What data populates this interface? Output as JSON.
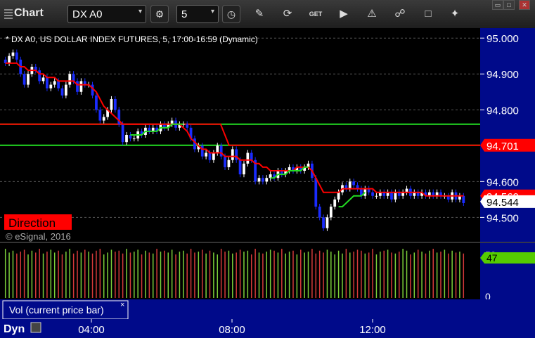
{
  "app": {
    "title": "Chart"
  },
  "toolbar": {
    "symbol": "DX A0",
    "interval": "5",
    "icons": [
      "settings-gear-icon",
      "clock-icon",
      "pencil-icon",
      "refresh-icon",
      "get-icon",
      "play-icon",
      "alert-icon",
      "link-icon",
      "note-icon",
      "twitter-icon"
    ]
  },
  "chart_header": "* DX A0, US DOLLAR INDEX FUTURES, 5, 17:00-16:59 (Dynamic)",
  "watermark": "© eSignal, 2016",
  "direction_label": "Direction",
  "volume_panel": {
    "label": "Vol (current price bar)",
    "current_value": "47",
    "scale_top": "50",
    "scale_bottom": "0"
  },
  "time_axis": {
    "labels": [
      "04:00",
      "08:00",
      "12:00"
    ],
    "left_label": "Dyn"
  },
  "colors": {
    "background": "#000000",
    "up_candle": "#ffffff",
    "down_candle": "#1a2cff",
    "ma_red": "#ff0000",
    "ma_green": "#22dd22",
    "price_tag_red": "#ff0000",
    "vol_tag_green": "#55cc00",
    "axis_blue": "#000a8a"
  },
  "chart_data": {
    "type": "candlestick",
    "symbol": "DX A0",
    "description": "US DOLLAR INDEX FUTURES",
    "interval": "5",
    "session": "17:00-16:59",
    "ylim": [
      94.44,
      95.02
    ],
    "y_ticks": [
      "95.000",
      "94.900",
      "94.800",
      "94.600",
      "94.500"
    ],
    "x_labels": [
      "04:00",
      "08:00",
      "12:00"
    ],
    "price_tags": [
      {
        "value": "94.701",
        "color": "red"
      },
      {
        "value": "94.560",
        "color": "red"
      },
      {
        "value": "94.544",
        "color": "white"
      }
    ],
    "close": [
      94.93,
      94.95,
      94.96,
      94.94,
      94.9,
      94.87,
      94.9,
      94.92,
      94.91,
      94.88,
      94.89,
      94.86,
      94.87,
      94.88,
      94.86,
      94.84,
      94.87,
      94.9,
      94.88,
      94.85,
      94.88,
      94.87,
      94.87,
      94.84,
      94.8,
      94.77,
      94.78,
      94.8,
      94.83,
      94.8,
      94.76,
      94.71,
      94.73,
      94.72,
      94.72,
      94.74,
      94.73,
      94.75,
      94.74,
      94.75,
      94.74,
      94.76,
      94.75,
      94.76,
      94.77,
      94.75,
      94.76,
      94.76,
      94.75,
      94.72,
      94.69,
      94.7,
      94.67,
      94.68,
      94.66,
      94.68,
      94.7,
      94.67,
      94.64,
      94.66,
      94.69,
      94.66,
      94.62,
      94.65,
      94.68,
      94.66,
      94.6,
      94.61,
      94.6,
      94.61,
      94.62,
      94.61,
      94.63,
      94.62,
      94.63,
      94.64,
      94.63,
      94.64,
      94.63,
      94.64,
      94.65,
      94.61,
      94.53,
      94.5,
      94.47,
      94.5,
      94.53,
      94.55,
      94.57,
      94.59,
      94.58,
      94.6,
      94.59,
      94.58,
      94.56,
      94.58,
      94.57,
      94.56,
      94.56,
      94.57,
      94.56,
      94.57,
      94.55,
      94.57,
      94.56,
      94.57,
      94.58,
      94.56,
      94.57,
      94.56,
      94.57,
      94.56,
      94.57,
      94.56,
      94.57,
      94.56,
      94.56,
      94.55,
      94.57,
      94.55,
      94.56,
      94.54
    ],
    "ma_red": [
      94.93,
      94.93,
      94.93,
      94.93,
      94.92,
      94.92,
      94.91,
      94.91,
      94.91,
      94.9,
      94.9,
      94.89,
      94.89,
      94.89,
      94.88,
      94.88,
      94.88,
      94.88,
      94.88,
      94.87,
      94.87,
      94.87,
      94.87,
      94.86,
      94.85,
      94.83,
      94.81,
      94.8,
      94.79,
      94.78,
      94.77,
      94.76,
      94.76,
      94.76,
      94.76,
      94.76,
      94.76,
      94.76,
      94.76,
      94.76,
      94.76,
      94.76,
      94.76,
      94.76,
      94.76,
      94.76,
      94.76,
      94.75,
      94.74,
      94.72,
      94.71,
      94.7,
      94.69,
      94.69,
      94.68,
      94.68,
      94.68,
      94.68,
      94.67,
      94.67,
      94.67,
      94.67,
      94.66,
      94.66,
      94.66,
      94.66,
      94.65,
      94.65,
      94.64,
      94.64,
      94.63,
      94.63,
      94.63,
      94.63,
      94.63,
      94.63,
      94.63,
      94.64,
      94.64,
      94.64,
      94.64,
      94.63,
      94.61,
      94.59,
      94.57,
      94.57,
      94.57,
      94.57,
      94.57,
      94.58,
      94.58,
      94.58,
      94.58,
      94.58,
      94.58,
      94.58,
      94.58,
      94.58,
      94.57,
      94.57,
      94.57,
      94.57,
      94.57,
      94.57,
      94.57,
      94.57,
      94.57,
      94.57,
      94.57,
      94.57,
      94.57,
      94.56,
      94.56,
      94.56,
      94.56,
      94.56,
      94.56,
      94.56,
      94.56,
      94.56,
      94.56,
      94.56
    ],
    "ma_green": [
      null,
      null,
      null,
      null,
      null,
      null,
      null,
      null,
      null,
      null,
      null,
      null,
      null,
      null,
      null,
      null,
      null,
      null,
      null,
      null,
      null,
      null,
      null,
      null,
      null,
      null,
      null,
      null,
      null,
      null,
      null,
      null,
      null,
      94.73,
      94.73,
      94.73,
      94.73,
      94.74,
      94.74,
      94.74,
      94.74,
      94.75,
      94.75,
      94.75,
      94.76,
      94.76,
      94.76,
      94.76,
      null,
      null,
      null,
      null,
      null,
      null,
      null,
      null,
      null,
      null,
      null,
      null,
      null,
      null,
      null,
      null,
      null,
      null,
      null,
      null,
      null,
      null,
      94.61,
      94.61,
      94.62,
      94.62,
      94.62,
      94.63,
      94.63,
      94.63,
      94.63,
      94.64,
      94.64,
      null,
      null,
      null,
      null,
      null,
      null,
      null,
      94.53,
      94.53,
      94.54,
      94.55,
      94.56,
      94.56,
      94.56,
      94.57,
      null,
      null,
      null,
      null,
      null,
      null,
      null,
      null,
      null,
      null,
      null,
      null,
      null,
      null,
      null,
      null,
      null,
      null,
      null,
      null,
      null,
      null
    ],
    "horizontal_lines": [
      {
        "name": "green-level-upper",
        "value": 94.76,
        "color": "green",
        "x_end_fraction": 0.4
      },
      {
        "name": "green-level-lower",
        "value": 94.701,
        "color": "green",
        "x_end_fraction": 0.4
      },
      {
        "name": "red-step-line",
        "from_value": 94.76,
        "to_value": 94.701,
        "color": "red"
      }
    ],
    "volume": [
      52,
      48,
      50,
      47,
      49,
      51,
      46,
      50,
      48,
      52,
      47,
      49,
      51,
      48,
      50,
      46,
      49,
      52,
      47,
      50,
      48,
      51,
      49,
      47,
      50,
      52,
      46,
      48,
      51,
      49,
      50,
      47,
      52,
      48,
      49,
      51,
      46,
      50,
      48,
      47,
      52,
      49,
      50,
      48,
      51,
      46,
      49,
      50,
      47,
      52,
      48,
      49,
      51,
      47,
      50,
      48,
      46,
      52,
      49,
      50,
      47,
      48,
      51,
      49,
      50,
      46,
      52,
      48,
      47,
      49,
      51,
      50,
      48,
      52,
      47,
      49,
      50,
      46,
      51,
      48,
      49,
      52,
      47,
      50,
      48,
      51,
      49,
      46,
      50,
      47,
      52,
      48,
      49,
      51,
      50,
      47,
      48,
      52,
      46,
      49,
      50,
      51,
      48,
      47,
      49,
      52,
      50,
      46,
      48,
      51,
      49,
      47,
      50,
      52,
      48,
      49,
      51,
      47,
      50,
      48,
      49,
      47
    ]
  }
}
